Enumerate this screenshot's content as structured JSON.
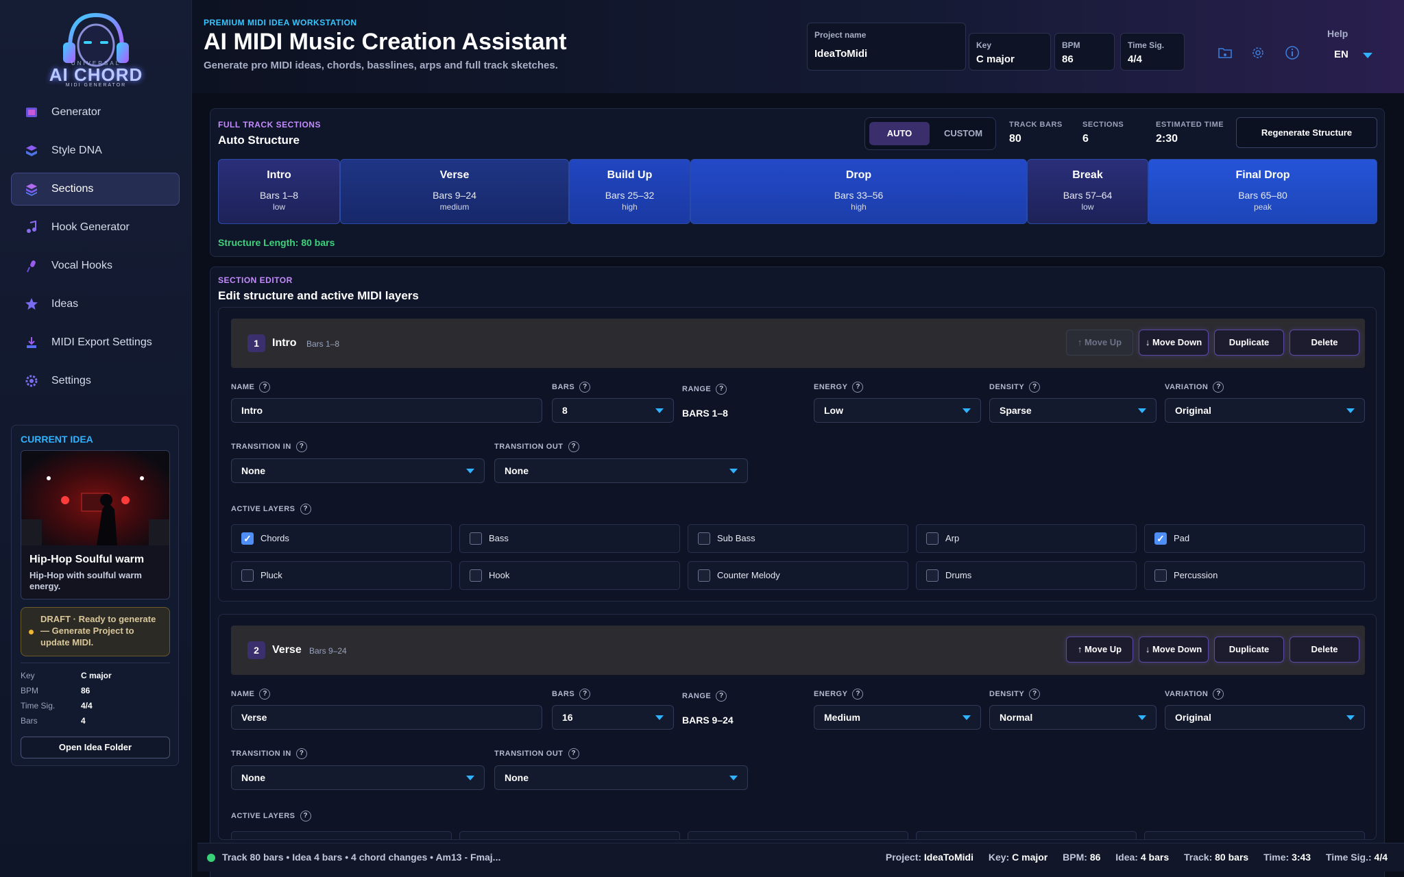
{
  "logo": {
    "top": "UNIVERSAL",
    "main": "AI CHORD",
    "sub": "MIDI GENERATOR"
  },
  "nav": [
    {
      "label": "Generator",
      "icon": "generator-icon",
      "active": false
    },
    {
      "label": "Style DNA",
      "icon": "style-dna-icon",
      "active": false
    },
    {
      "label": "Sections",
      "icon": "sections-icon",
      "active": true
    },
    {
      "label": "Hook Generator",
      "icon": "music-note-icon",
      "active": false
    },
    {
      "label": "Vocal Hooks",
      "icon": "microphone-icon",
      "active": false
    },
    {
      "label": "Ideas",
      "icon": "star-icon",
      "active": false
    },
    {
      "label": "MIDI Export Settings",
      "icon": "download-icon",
      "active": false
    },
    {
      "label": "Settings",
      "icon": "gear-icon",
      "active": false
    }
  ],
  "current_idea": {
    "heading": "CURRENT IDEA",
    "title": "Hip-Hop Soulful warm",
    "description": "Hip-Hop with soulful warm energy.",
    "draft_notice": "DRAFT · Ready to generate — Generate Project to update MIDI.",
    "details": [
      {
        "key": "Key",
        "value": "C major"
      },
      {
        "key": "BPM",
        "value": "86"
      },
      {
        "key": "Time Sig.",
        "value": "4/4"
      },
      {
        "key": "Bars",
        "value": "4"
      }
    ],
    "open_folder": "Open Idea Folder"
  },
  "header": {
    "eyebrow": "PREMIUM MIDI IDEA WORKSTATION",
    "title": "AI MIDI Music Creation Assistant",
    "subtitle": "Generate pro MIDI ideas, chords, basslines, arps and full track sketches.",
    "project_name_label": "Project name",
    "project_name": "IdeaToMidi",
    "key_label": "Key",
    "key": "C major",
    "bpm_label": "BPM",
    "bpm": "86",
    "timesig_label": "Time Sig.",
    "timesig": "4/4",
    "help": "Help",
    "lang": "EN"
  },
  "structure": {
    "eyebrow": "FULL TRACK SECTIONS",
    "title": "Auto Structure",
    "toggle_auto": "AUTO",
    "toggle_custom": "CUSTOM",
    "track_bars_label": "TRACK BARS",
    "track_bars": "80",
    "sections_label": "SECTIONS",
    "sections": "6",
    "est_time_label": "ESTIMATED TIME",
    "est_time": "2:30",
    "regenerate": "Regenerate Structure",
    "blocks": [
      {
        "name": "Intro",
        "bars": "Bars 1–8",
        "energy": "low",
        "color": "#22286a"
      },
      {
        "name": "Verse",
        "bars": "Bars 9–24",
        "energy": "medium",
        "color": "#1c2f7e"
      },
      {
        "name": "Build Up",
        "bars": "Bars 25–32",
        "energy": "high",
        "color": "#1c3bb0"
      },
      {
        "name": "Drop",
        "bars": "Bars 33–56",
        "energy": "high",
        "color": "#1e3fbd"
      },
      {
        "name": "Break",
        "bars": "Bars 57–64",
        "energy": "low",
        "color": "#22286a"
      },
      {
        "name": "Final Drop",
        "bars": "Bars 65–80",
        "energy": "peak",
        "color": "#1e46c9"
      }
    ],
    "length": "Structure Length: 80 bars"
  },
  "editor": {
    "eyebrow": "SECTION EDITOR",
    "title": "Edit structure and active MIDI layers",
    "labels": {
      "name": "NAME",
      "bars": "BARS",
      "range": "RANGE",
      "energy": "ENERGY",
      "density": "DENSITY",
      "variation": "VARIATION",
      "transition_in": "TRANSITION IN",
      "transition_out": "TRANSITION OUT",
      "active_layers": "ACTIVE LAYERS",
      "q": "?"
    },
    "buttons": {
      "move_up": "↑ Move Up",
      "move_down": "↓ Move Down",
      "duplicate": "Duplicate",
      "delete": "Delete"
    },
    "sections": [
      {
        "index": "1",
        "name": "Intro",
        "bars_text": "Bars 1–8",
        "bars": "8",
        "range": "BARS 1–8",
        "energy": "Low",
        "density": "Sparse",
        "variation": "Original",
        "transition_in": "None",
        "transition_out": "None",
        "layers": [
          {
            "label": "Chords",
            "checked": true
          },
          {
            "label": "Bass",
            "checked": false
          },
          {
            "label": "Sub Bass",
            "checked": false
          },
          {
            "label": "Arp",
            "checked": false
          },
          {
            "label": "Pad",
            "checked": true
          },
          {
            "label": "Pluck",
            "checked": false
          },
          {
            "label": "Hook",
            "checked": false
          },
          {
            "label": "Counter Melody",
            "checked": false
          },
          {
            "label": "Drums",
            "checked": false
          },
          {
            "label": "Percussion",
            "checked": false
          }
        ]
      },
      {
        "index": "2",
        "name": "Verse",
        "bars_text": "Bars 9–24",
        "bars": "16",
        "range": "BARS 9–24",
        "energy": "Medium",
        "density": "Normal",
        "variation": "Original",
        "transition_in": "None",
        "transition_out": "None"
      }
    ]
  },
  "statusbar": {
    "left": "Track 80 bars • Idea 4 bars • 4 chord changes • Am13 - Fmaj...",
    "items": [
      {
        "key": "Project:",
        "value": "IdeaToMidi"
      },
      {
        "key": "Key:",
        "value": "C major"
      },
      {
        "key": "BPM:",
        "value": "86"
      },
      {
        "key": "Idea:",
        "value": "4 bars"
      },
      {
        "key": "Track:",
        "value": "80 bars"
      },
      {
        "key": "Time:",
        "value": "3:43"
      },
      {
        "key": "Time Sig.:",
        "value": "4/4"
      }
    ]
  }
}
